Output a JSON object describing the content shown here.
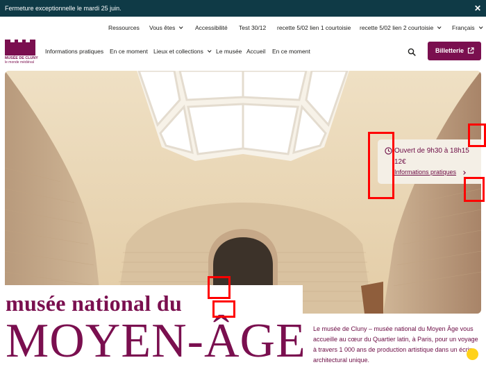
{
  "alert": {
    "text": "Fermeture exceptionnelle le mardi 25 juin.",
    "close_symbol": "✕"
  },
  "utility_nav": [
    {
      "label": "Ressources",
      "has_dropdown": false
    },
    {
      "label": "Vous êtes",
      "has_dropdown": true
    },
    {
      "label": "Accessibilité",
      "has_dropdown": false
    },
    {
      "label": "Test 30/12",
      "has_dropdown": false
    },
    {
      "label": "recette 5/02 lien 1 courtoisie",
      "has_dropdown": false
    },
    {
      "label": "recette 5/02 lien 2 courtoisie",
      "has_dropdown": true
    },
    {
      "label": "Français",
      "has_dropdown": true
    }
  ],
  "logo": {
    "name": "MUSÉE DE CLUNY",
    "tagline": "le monde médiéval"
  },
  "main_nav": [
    {
      "label": "Informations pratiques",
      "has_dropdown": false
    },
    {
      "label": "En ce moment",
      "has_dropdown": false
    },
    {
      "label": "Lieux et collections",
      "has_dropdown": true
    },
    {
      "label": "Le musée",
      "has_dropdown": false
    },
    {
      "label": "Accueil",
      "has_dropdown": false
    },
    {
      "label": "En ce moment",
      "has_dropdown": false
    }
  ],
  "header": {
    "search_icon": "search-icon",
    "ticket_label": "Billetterie",
    "ticket_icon": "external-link-icon"
  },
  "info_card": {
    "hours": "Ouvert de 9h30 à 18h15",
    "price": "12€",
    "link_label": "Informations pratiques"
  },
  "title": {
    "line1": "musée national du",
    "line2": "MOYEN-ÂGE"
  },
  "description": "Le musée de Cluny – musée national du Moyen Âge vous accueille au cœur du Quartier latin, à Paris, pour un voyage à travers 1 000 ans de production artistique dans un écrin architectural unique.",
  "colors": {
    "brand": "#7a0f4f",
    "alert_bg": "#0f3a46",
    "annotation": "#ff0000"
  }
}
